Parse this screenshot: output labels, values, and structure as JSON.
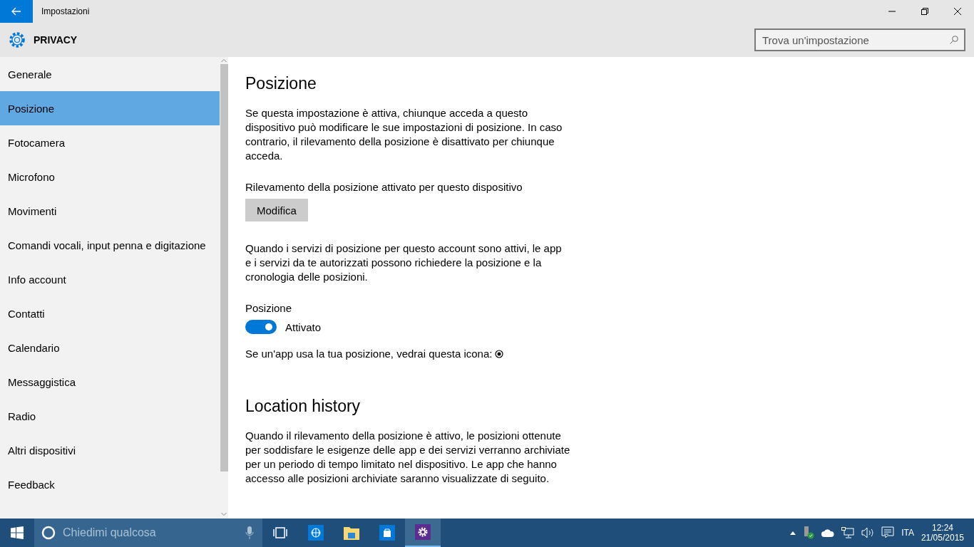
{
  "window": {
    "title": "Impostazioni"
  },
  "header": {
    "title": "PRIVACY",
    "search": {
      "placeholder": "Trova un'impostazione"
    }
  },
  "sidebar": {
    "items": [
      {
        "label": "Generale",
        "selected": false
      },
      {
        "label": "Posizione",
        "selected": true
      },
      {
        "label": "Fotocamera",
        "selected": false
      },
      {
        "label": "Microfono",
        "selected": false
      },
      {
        "label": "Movimenti",
        "selected": false
      },
      {
        "label": "Comandi vocali, input penna e digitazione",
        "selected": false
      },
      {
        "label": "Info account",
        "selected": false
      },
      {
        "label": "Contatti",
        "selected": false
      },
      {
        "label": "Calendario",
        "selected": false
      },
      {
        "label": "Messaggistica",
        "selected": false
      },
      {
        "label": "Radio",
        "selected": false
      },
      {
        "label": "Altri dispositivi",
        "selected": false
      },
      {
        "label": "Feedback",
        "selected": false
      }
    ]
  },
  "content": {
    "heading": "Posizione",
    "intro": "Se questa impostazione è attiva, chiunque acceda a questo dispositivo può modificare le sue impostazioni di posizione. In caso contrario, il rilevamento della posizione è disattivato per chiunque acceda.",
    "device_status": "Rilevamento della posizione attivato per questo dispositivo",
    "edit_button": "Modifica",
    "account_text": "Quando i servizi di posizione per questo account sono attivi, le app e i servizi da te autorizzati possono richiedere la posizione e la cronologia delle posizioni.",
    "toggle": {
      "label": "Posizione",
      "on": true,
      "state_text": "Attivato"
    },
    "icon_note": "Se un'app usa la tua posizione, vedrai questa icona:",
    "history_heading": "Location history",
    "history_text": "Quando il rilevamento della posizione è attivo, le posizioni ottenute per soddisfare le esigenze delle app e dei servizi verranno archiviate per un periodo di tempo limitato nel dispositivo. Le app che hanno accesso alle posizioni archiviate saranno visualizzate di seguito."
  },
  "taskbar": {
    "search_placeholder": "Chiedimi qualcosa",
    "apps": [
      {
        "kind": "browser",
        "selected": false
      },
      {
        "kind": "explorer",
        "selected": false
      },
      {
        "kind": "store",
        "selected": false
      },
      {
        "kind": "settings",
        "selected": true
      }
    ],
    "language": "ITA",
    "time": "12:24",
    "date": "21/05/2015"
  }
}
